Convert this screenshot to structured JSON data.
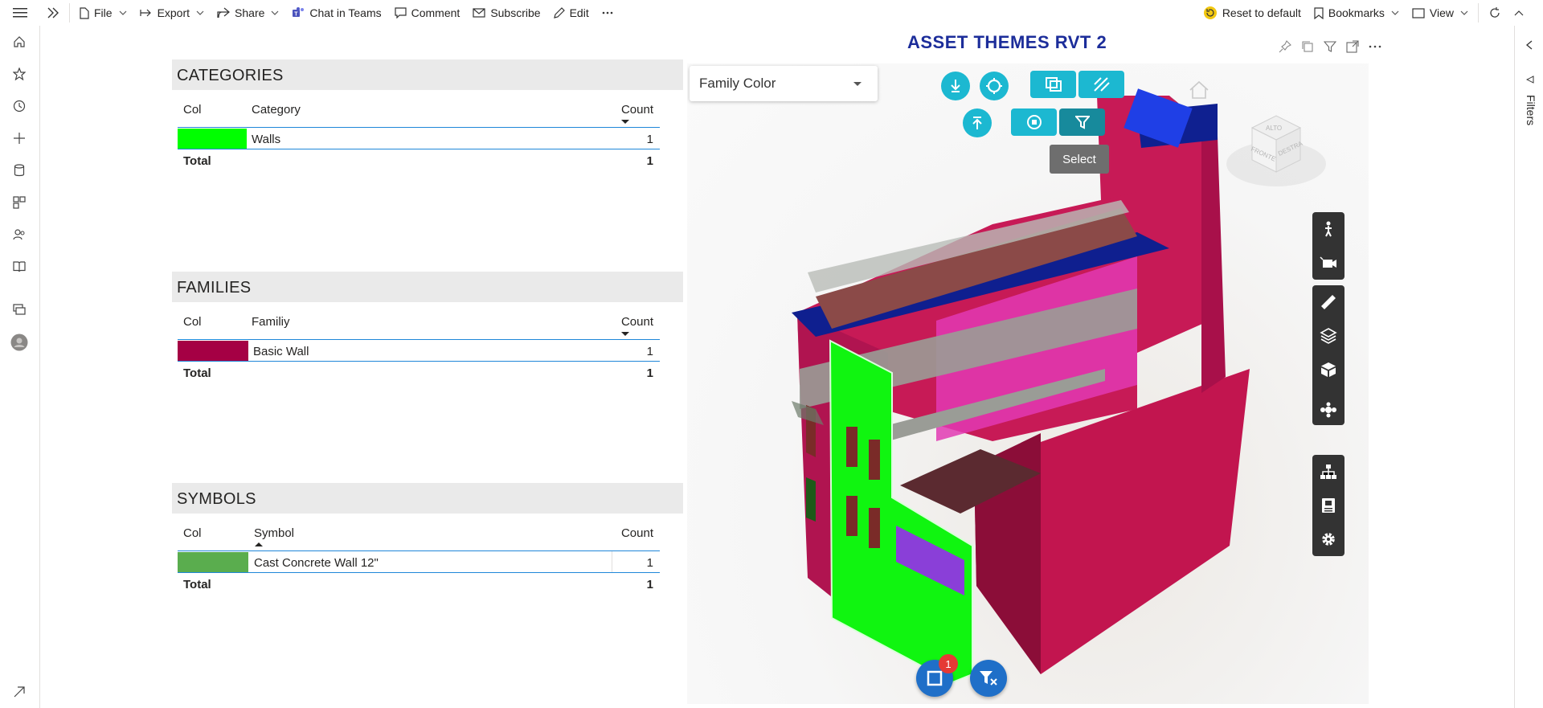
{
  "toolbar": {
    "file": "File",
    "export": "Export",
    "share": "Share",
    "chat": "Chat in Teams",
    "comment": "Comment",
    "subscribe": "Subscribe",
    "edit": "Edit",
    "reset": "Reset to default",
    "bookmarks": "Bookmarks",
    "view": "View"
  },
  "nav_icons": [
    "hamburger-icon",
    "home-icon",
    "star-icon",
    "clock-icon",
    "plus-icon",
    "database-icon",
    "apps-icon",
    "people-icon",
    "book-icon",
    "workspaces-icon",
    "avatar-icon",
    "expand-icon"
  ],
  "filters": {
    "label": "Filters"
  },
  "categories": {
    "title": "CATEGORIES",
    "headers": {
      "col": "Col",
      "name": "Category",
      "count": "Count"
    },
    "rows": [
      {
        "color": "#00ff00",
        "name": "Walls",
        "count": "1"
      }
    ],
    "total": {
      "label": "Total",
      "count": "1"
    }
  },
  "families": {
    "title": "FAMILIES",
    "headers": {
      "col": "Col",
      "name": "Familiy",
      "count": "Count"
    },
    "rows": [
      {
        "color": "#a50044",
        "name": "Basic Wall",
        "count": "1"
      }
    ],
    "total": {
      "label": "Total",
      "count": "1"
    }
  },
  "symbols": {
    "title": "SYMBOLS",
    "headers": {
      "col": "Col",
      "name": "Symbol",
      "count": "Count"
    },
    "rows": [
      {
        "color": "#5aad4e",
        "name": "Cast Concrete Wall 12\"",
        "count": "1"
      }
    ],
    "total": {
      "label": "Total",
      "count": "1"
    }
  },
  "viewer": {
    "title": "ASSET THEMES RVT 2",
    "dropdown_value": "Family Color",
    "tooltip": "Select",
    "badge_count": "1",
    "cube_labels": [
      "ALTO",
      "FRONTE",
      "DESTRA"
    ],
    "accent": "#1cb8d1"
  }
}
